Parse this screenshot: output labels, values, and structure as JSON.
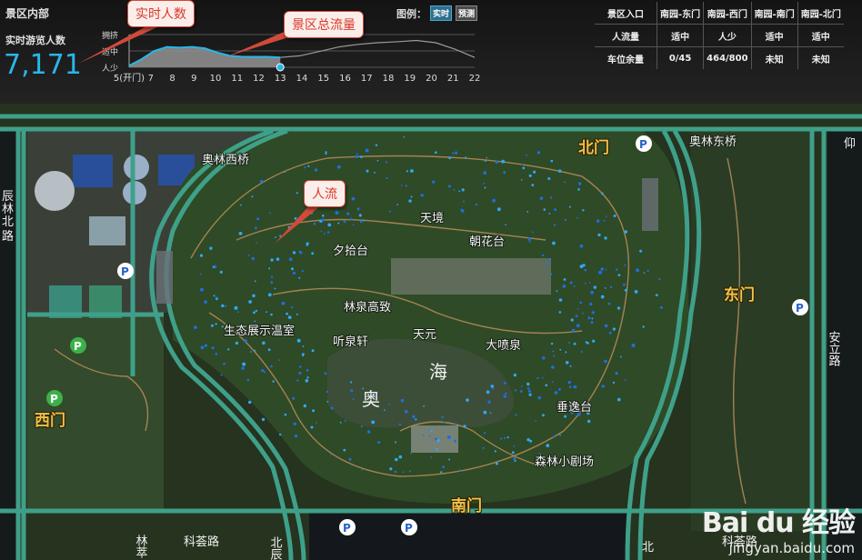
{
  "header": {
    "section_title": "景区内部",
    "visitor_label": "实时游览人数",
    "visitor_count": "7,171",
    "legend_label": "图例：",
    "legend_realtime": "实时",
    "legend_forecast": "预测"
  },
  "chart_data": {
    "type": "area",
    "y_levels": [
      "拥挤",
      "适中",
      "人少"
    ],
    "x_ticks": [
      "5(开门)",
      "7",
      "8",
      "9",
      "10",
      "11",
      "12",
      "13",
      "14",
      "15",
      "16",
      "17",
      "18",
      "19",
      "20",
      "21",
      "22"
    ],
    "series": [
      {
        "values": [
          0.05,
          0.25,
          0.5,
          0.62,
          0.6,
          0.62,
          0.58,
          0.45,
          0.35,
          0.32,
          0.32,
          0.32,
          0.3
        ]
      },
      {
        "values": [
          0.3,
          0.35,
          0.48,
          0.62,
          0.7,
          0.75,
          0.78,
          0.82,
          0.75,
          0.55,
          0.3
        ]
      }
    ],
    "current_x": "13",
    "colors": {
      "actual": "#29b6e8",
      "forecast": "#9a9a9a"
    }
  },
  "entrances": {
    "header": [
      "景区入口",
      "南园-东门",
      "南园-西门",
      "南园-南门",
      "南园-北门"
    ],
    "rows": [
      {
        "label": "人流量",
        "values": [
          "适中",
          "人少",
          "适中",
          "适中"
        ]
      },
      {
        "label": "车位余量",
        "values": [
          "0/45",
          "464/800",
          "未知",
          "未知"
        ]
      }
    ]
  },
  "map": {
    "gates": {
      "north": "北门",
      "east": "东门",
      "west": "西门",
      "south": "南门"
    },
    "places": [
      "奥林西桥",
      "奥林东桥",
      "天境",
      "朝花台",
      "夕拾台",
      "林泉高致",
      "生态展示温室",
      "听泉轩",
      "天元",
      "大喷泉",
      "垂逸台",
      "森林小剧场"
    ],
    "lake": [
      "奥",
      "海"
    ],
    "roads": [
      "科荟路",
      "科荟路",
      "安立路",
      "仰",
      "林萃",
      "北辰",
      "北",
      "路",
      "林",
      "北",
      "辰"
    ]
  },
  "callouts": {
    "realtime": "实时人数",
    "total_flow": "景区总流量",
    "people_flow": "人流"
  },
  "watermark": {
    "logo": "Bai du 经验",
    "url": "jingyan.baidu.com"
  }
}
